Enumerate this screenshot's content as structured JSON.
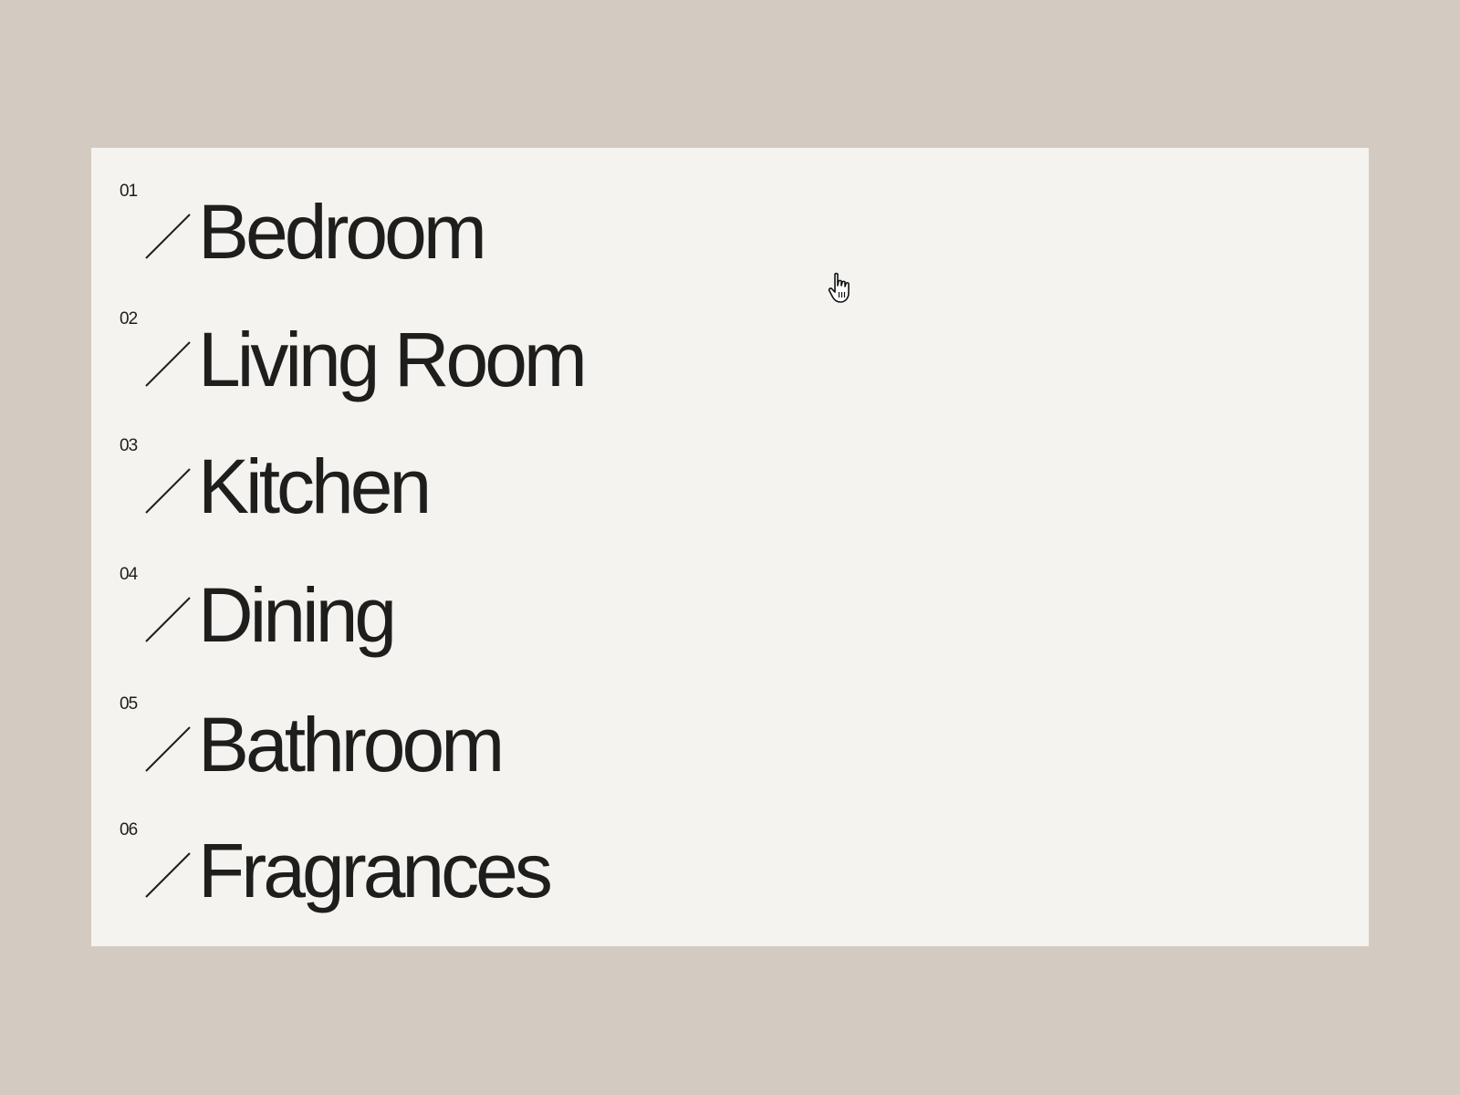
{
  "menu": {
    "items": [
      {
        "number": "01",
        "label": "Bedroom"
      },
      {
        "number": "02",
        "label": "Living Room"
      },
      {
        "number": "03",
        "label": "Kitchen"
      },
      {
        "number": "04",
        "label": "Dining"
      },
      {
        "number": "05",
        "label": "Bathroom"
      },
      {
        "number": "06",
        "label": "Fragrances"
      }
    ]
  },
  "colors": {
    "background": "#d3cbc1",
    "panel": "#f4f3ef",
    "text": "#1e1e1c"
  },
  "icons": {
    "separator": "slash-icon",
    "cursor": "hand-pointer-cursor-icon"
  }
}
